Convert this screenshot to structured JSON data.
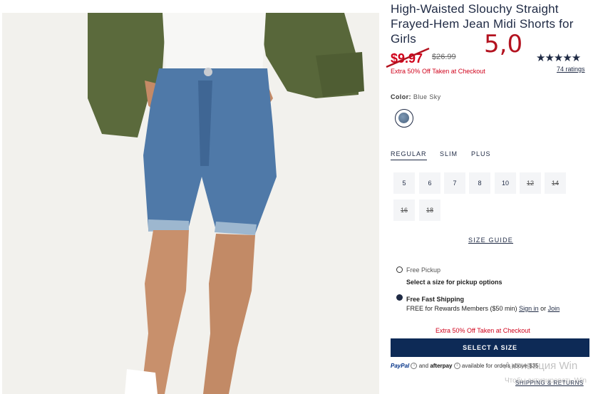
{
  "product": {
    "title": "High-Waisted Slouchy Straight Frayed-Hem Jean Midi Shorts for Girls",
    "sale_price": "$9.97",
    "regular_price": "$26.99",
    "promo": "Extra 50% Off Taken at Checkout",
    "annotation": "5,0",
    "stars": "★★★★★",
    "rating_value": 4.5,
    "ratings_count": "74 ratings"
  },
  "color": {
    "label": "Color:",
    "value": "Blue Sky",
    "swatch_color": "#5f7c9c"
  },
  "fit_tabs": [
    {
      "label": "REGULAR",
      "active": true
    },
    {
      "label": "SLIM",
      "active": false
    },
    {
      "label": "PLUS",
      "active": false
    }
  ],
  "sizes": [
    {
      "label": "5",
      "available": true
    },
    {
      "label": "6",
      "available": true
    },
    {
      "label": "7",
      "available": true
    },
    {
      "label": "8",
      "available": true
    },
    {
      "label": "10",
      "available": true
    },
    {
      "label": "12",
      "available": false
    },
    {
      "label": "14",
      "available": false
    },
    {
      "label": "16",
      "available": false
    },
    {
      "label": "18",
      "available": false
    }
  ],
  "size_guide": "SIZE GUIDE",
  "fulfillment": {
    "pickup_label": "Free Pickup",
    "pickup_sub": "Select a size for pickup options",
    "shipping_label": "Free Fast Shipping",
    "shipping_sub_prefix": "FREE for Rewards Members ($50 min)",
    "sign_in": "Sign in",
    "or": "or",
    "join": "Join"
  },
  "promo_checkout": "Extra 50% Off Taken at Checkout",
  "cta_label": "SELECT A SIZE",
  "payment": {
    "paypal": "PayPal",
    "and": "and",
    "afterpay": "afterpay",
    "available_text": "available for orders above $35"
  },
  "shipping_returns": "SHIPPING & RETURNS",
  "watermark": {
    "line1": "Активация Win",
    "line2": "Чтобы активировать Win"
  },
  "colors": {
    "brand_navy": "#0d2a56",
    "sale_red": "#d0021b"
  }
}
